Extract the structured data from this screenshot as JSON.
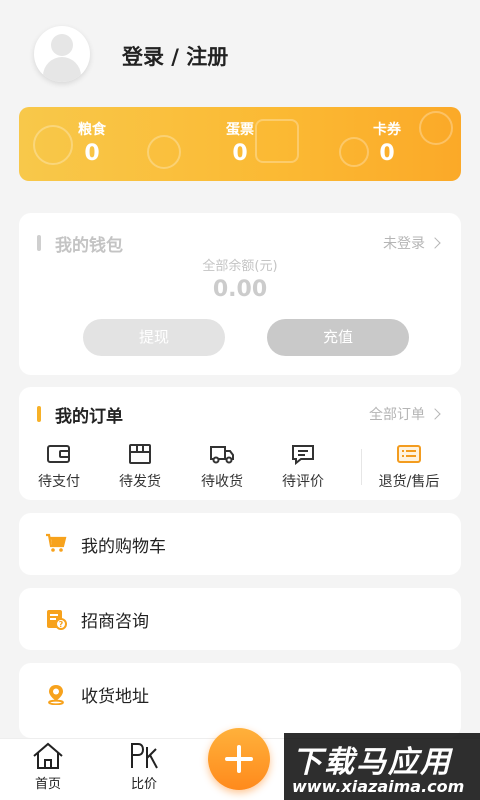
{
  "profile": {
    "login_label": "登录 / 注册"
  },
  "stats": [
    {
      "label": "粮食",
      "value": "0"
    },
    {
      "label": "蛋票",
      "value": "0"
    },
    {
      "label": "卡券",
      "value": "0"
    }
  ],
  "wallet": {
    "title": "我的钱包",
    "status": "未登录",
    "balance_label": "全部余额(元)",
    "balance": "0.00",
    "withdraw_label": "提现",
    "recharge_label": "充值"
  },
  "orders": {
    "title": "我的订单",
    "all_link": "全部订单",
    "items": [
      {
        "label": "待支付",
        "icon": "wallet-icon"
      },
      {
        "label": "待发货",
        "icon": "box-icon"
      },
      {
        "label": "待收货",
        "icon": "truck-icon"
      },
      {
        "label": "待评价",
        "icon": "comment-icon"
      },
      {
        "label": "退货/售后",
        "icon": "list-icon"
      }
    ]
  },
  "menu": [
    {
      "label": "我的购物车",
      "icon": "cart-icon"
    },
    {
      "label": "招商咨询",
      "icon": "consult-icon"
    },
    {
      "label": "收货地址",
      "icon": "location-icon"
    }
  ],
  "tabbar": {
    "items": [
      {
        "label": "首页",
        "icon": "home-icon"
      },
      {
        "label": "比价",
        "icon": "pk-icon"
      }
    ],
    "fab_icon": "plus-icon"
  },
  "watermark": {
    "main": "下载马应用",
    "sub": "www.xiazaima.com"
  },
  "colors": {
    "accent": "#f7b128",
    "orange": "#ff8a1c",
    "muted": "#cccccc"
  }
}
